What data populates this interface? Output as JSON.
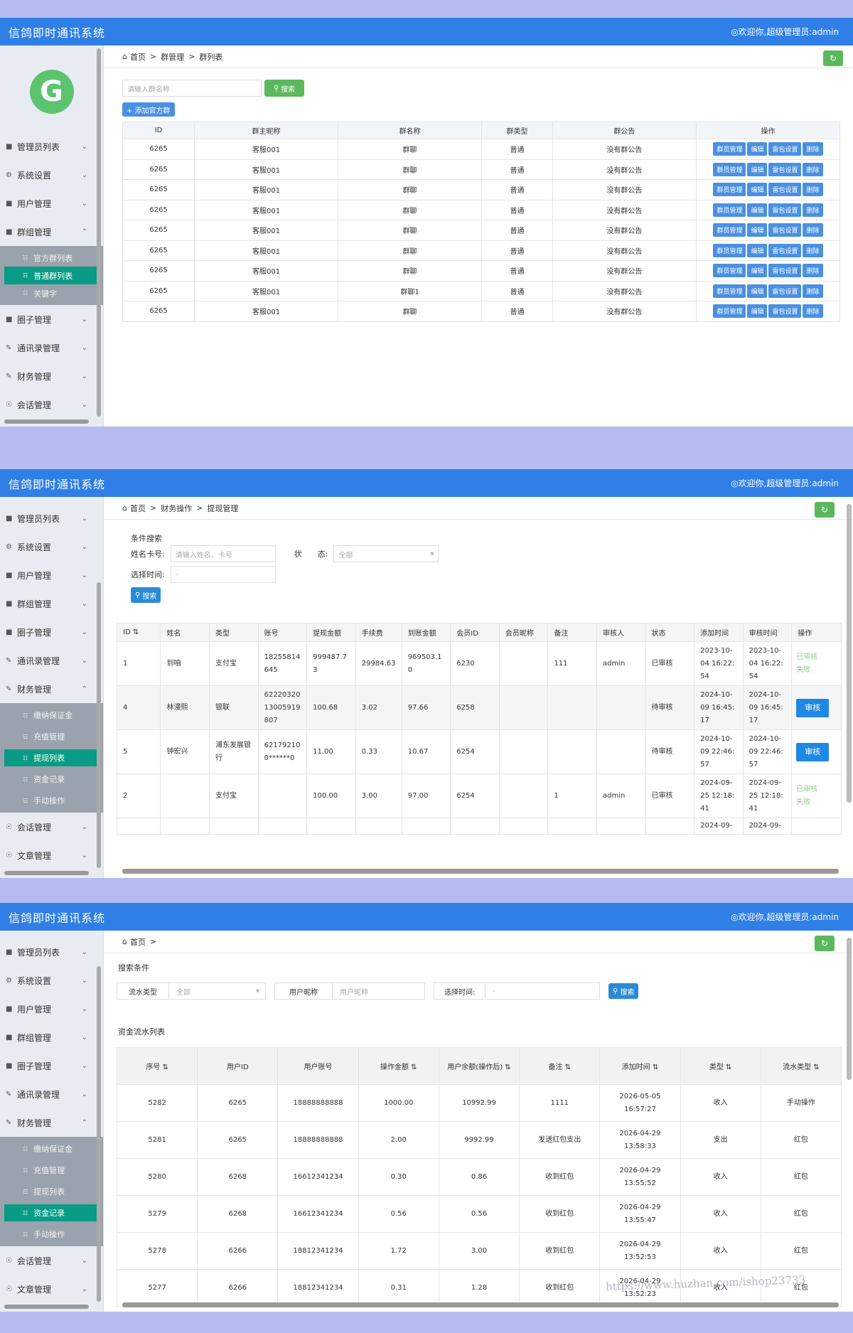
{
  "app_title": "信鸽即时通讯系统",
  "welcome": "◎欢迎你,超级管理员:admin",
  "avatar_letter": "G",
  "menu": {
    "admin_list": "管理员列表",
    "system": "系统设置",
    "user": "用户管理",
    "group": "群组管理",
    "moments": "圈子管理",
    "contacts": "通讯录管理",
    "finance": "财务管理",
    "session": "会话管理",
    "article": "文章管理"
  },
  "group_sub": [
    "官方群列表",
    "普通群列表",
    "关键字"
  ],
  "finance_sub": [
    "缴纳保证金",
    "充值管理",
    "提现列表",
    "资金记录",
    "手动操作"
  ],
  "panel1": {
    "breadcrumb": [
      "首页",
      "群管理",
      "群列表"
    ],
    "search_placeholder": "请输入群名称",
    "search_btn": "搜索",
    "add_btn": "+ 添加官方群",
    "headers": [
      "ID",
      "群主昵称",
      "群名称",
      "群类型",
      "群公告",
      "操作"
    ],
    "ops": [
      "群员管理",
      "编辑",
      "雷包设置",
      "删除"
    ],
    "rows": [
      [
        "6265",
        "客服001",
        "群聊",
        "普通",
        "没有群公告"
      ],
      [
        "6265",
        "客服001",
        "群聊",
        "普通",
        "没有群公告"
      ],
      [
        "6265",
        "客服001",
        "群聊",
        "普通",
        "没有群公告"
      ],
      [
        "6265",
        "客服001",
        "群聊",
        "普通",
        "没有群公告"
      ],
      [
        "6265",
        "客服001",
        "群聊",
        "普通",
        "没有群公告"
      ],
      [
        "6265",
        "客服001",
        "群聊",
        "普通",
        "没有群公告"
      ],
      [
        "6265",
        "客服001",
        "群聊",
        "普通",
        "没有群公告"
      ],
      [
        "6265",
        "客服001",
        "群聊1",
        "普通",
        "没有群公告"
      ],
      [
        "6265",
        "客服001",
        "群聊",
        "普通",
        "没有群公告"
      ]
    ]
  },
  "panel2": {
    "breadcrumb": [
      "首页",
      "财务操作",
      "提现管理"
    ],
    "cond_title": "条件搜索",
    "name_label": "姓名卡号:",
    "name_placeholder": "请输入姓名、卡号",
    "status_label": "状　　态:",
    "status_value": "全部",
    "time_label": "选择时间:",
    "time_value": "-",
    "search_btn": "搜索",
    "headers": [
      "ID",
      "姓名",
      "类型",
      "账号",
      "提现金额",
      "手续费",
      "到账金额",
      "会员ID",
      "会员昵称",
      "备注",
      "审核人",
      "状态",
      "添加时间",
      "审核时间",
      "操作"
    ],
    "rows": [
      {
        "id": "1",
        "name": "到咱",
        "type": "支付宝",
        "account": "18255814645",
        "amount": "999487.73",
        "fee": "29984.63",
        "received": "969503.10",
        "member_id": "6230",
        "nickname": "",
        "note": "111",
        "reviewer": "admin",
        "status": "已审核",
        "added": "2023-10-04 16:22:54",
        "reviewed": "2023-10-04 16:22:54",
        "op": [
          "已审核",
          "失败"
        ]
      },
      {
        "id": "4",
        "name": "林漫熙",
        "type": "银联",
        "account": "6222032013005919807",
        "amount": "100.68",
        "fee": "3.02",
        "received": "97.66",
        "member_id": "6258",
        "nickname": "",
        "note": "",
        "reviewer": "",
        "status": "待审核",
        "added": "2024-10-09 16:45:17",
        "reviewed": "2024-10-09 16:45:17",
        "op": [
          "审核"
        ]
      },
      {
        "id": "5",
        "name": "钟宏兴",
        "type": "浦东发展银行",
        "account": "621792100******0",
        "amount": "11.00",
        "fee": "0.33",
        "received": "10.67",
        "member_id": "6254",
        "nickname": "",
        "note": "",
        "reviewer": "",
        "status": "待审核",
        "added": "2024-10-09 22:46:57",
        "reviewed": "2024-10-09 22:46:57",
        "op": [
          "审核"
        ]
      },
      {
        "id": "2",
        "name": "",
        "type": "支付宝",
        "account": "",
        "amount": "100.00",
        "fee": "3.00",
        "received": "97.00",
        "member_id": "6254",
        "nickname": "",
        "note": "1",
        "reviewer": "admin",
        "status": "已审核",
        "added": "2024-09-25 12:18:41",
        "reviewed": "2024-09-25 12:18:41",
        "op": [
          "已审核",
          "失败"
        ]
      },
      {
        "id": "",
        "name": "",
        "type": "",
        "account": "",
        "amount": "",
        "fee": "",
        "received": "",
        "member_id": "",
        "nickname": "",
        "note": "",
        "reviewer": "",
        "status": "",
        "added": "2024-09-",
        "reviewed": "2024-09-",
        "op": []
      }
    ]
  },
  "panel3": {
    "breadcrumb": [
      "首页",
      ""
    ],
    "cond_title": "搜索条件",
    "flow_type_label": "流水类型",
    "flow_type_value": "全部",
    "nick_label": "用户昵称",
    "nick_placeholder": "用户昵称",
    "time_label": "选择时间:",
    "time_value": "-",
    "search_btn": "搜索",
    "list_title": "资金流水列表",
    "headers": [
      "序号",
      "用户ID",
      "用户账号",
      "操作金额",
      "用户余额(操作后)",
      "备注",
      "添加时间",
      "类型",
      "流水类型"
    ],
    "rows": [
      [
        "5282",
        "6265",
        "18888888888",
        "1000.00",
        "10992.99",
        "1111",
        "2026-05-05 16:57:27",
        "收入",
        "手动操作"
      ],
      [
        "5281",
        "6265",
        "18888888888",
        "2.00",
        "9992.99",
        "发送红包支出",
        "2026-04-29 13:58:33",
        "支出",
        "红包"
      ],
      [
        "5280",
        "6268",
        "16612341234",
        "0.30",
        "0.86",
        "收到红包",
        "2026-04-29 13:55:52",
        "收入",
        "红包"
      ],
      [
        "5279",
        "6268",
        "16612341234",
        "0.56",
        "0.56",
        "收到红包",
        "2026-04-29 13:55:47",
        "收入",
        "红包"
      ],
      [
        "5278",
        "6266",
        "18812341234",
        "1.72",
        "3.00",
        "收到红包",
        "2026-04-29 13:52:53",
        "收入",
        "红包"
      ],
      [
        "5277",
        "6266",
        "18812341234",
        "0.31",
        "1.28",
        "收到红包",
        "2026-04-29 13:52:23",
        "收入",
        "红包"
      ]
    ]
  },
  "watermark": "https://www.huzhan.com/ishop23733"
}
